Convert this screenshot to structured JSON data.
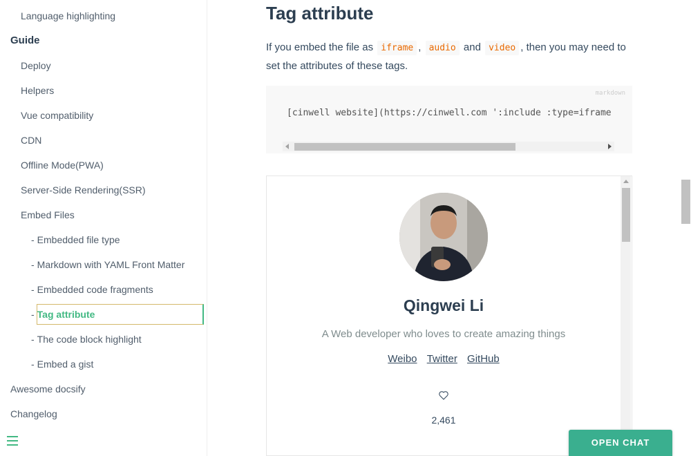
{
  "sidebar": {
    "items": [
      {
        "label": "Language highlighting"
      },
      {
        "label": "Guide"
      },
      {
        "label": "Deploy"
      },
      {
        "label": "Helpers"
      },
      {
        "label": "Vue compatibility"
      },
      {
        "label": "CDN"
      },
      {
        "label": "Offline Mode(PWA)"
      },
      {
        "label": "Server-Side Rendering(SSR)"
      },
      {
        "label": "Embed Files"
      },
      {
        "label": "Embedded file type"
      },
      {
        "label": "Markdown with YAML Front Matter"
      },
      {
        "label": "Embedded code fragments"
      },
      {
        "label": "Tag attribute"
      },
      {
        "label": "The code block highlight"
      },
      {
        "label": "Embed a gist"
      },
      {
        "label": "Awesome docsify"
      },
      {
        "label": "Changelog"
      }
    ],
    "dash": "-",
    "menu_icon": "hamburger-icon"
  },
  "main": {
    "heading": "Tag attribute",
    "para_1": "If you embed the file as",
    "code_iframe": "iframe",
    "sep_comma": ",",
    "code_audio": "audio",
    "sep_and": "and",
    "code_video": "video",
    "para_2": ", then you may need to set the attributes of these tags.",
    "codeblock": {
      "lang": "markdown",
      "code": "[cinwell website](https://cinwell.com ':include :type=iframe w"
    },
    "profile": {
      "name": "Qingwei Li",
      "description": "A Web developer who loves to create amazing things",
      "links": [
        "Weibo",
        "Twitter",
        "GitHub"
      ],
      "like_icon": "heart-icon",
      "likes": "2,461"
    }
  },
  "chat": {
    "label": "OPEN CHAT"
  },
  "colors": {
    "accent": "#42b983",
    "chat": "#3aaf8f",
    "code_inline": "#e96900"
  }
}
